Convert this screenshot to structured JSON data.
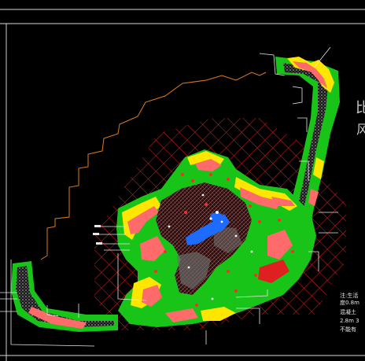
{
  "drawing": {
    "title_lines": [
      "比",
      "风"
    ],
    "notes": [
      "注:生活",
      "度0.8m",
      "混凝土",
      "2.8m 3",
      "不能有"
    ],
    "colors": {
      "background": "#000000",
      "boundary": "#e07a1a",
      "hatch": "#ff2020",
      "grass": "#19c419",
      "shrub": "#ff6a6a",
      "yellow": "#ffe600",
      "water": "#1e6cff",
      "paving": "#9a9a9a",
      "text": "#e8e8e8"
    }
  }
}
